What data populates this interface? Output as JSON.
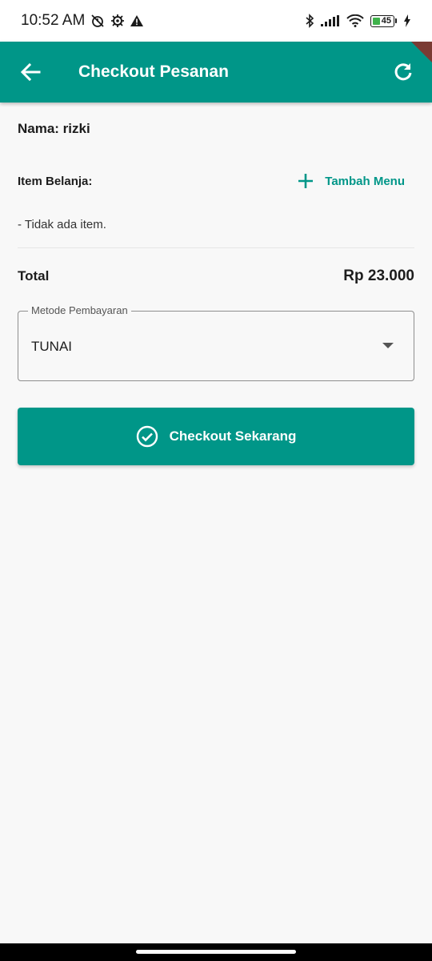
{
  "status_bar": {
    "time": "10:52 AM",
    "battery_level": "45",
    "icons": [
      "alarm-off-icon",
      "settings-gear-icon",
      "warning-icon",
      "bluetooth-icon",
      "signal-icon",
      "wifi-icon",
      "battery-icon",
      "charging-icon"
    ]
  },
  "app_bar": {
    "title": "Checkout Pesanan",
    "back_icon": "arrow-left-icon",
    "refresh_icon": "refresh-icon"
  },
  "order": {
    "name_line": "Nama: rizki",
    "items_label": "Item Belanja:",
    "add_menu_label": "Tambah Menu",
    "empty_items_text": "- Tidak ada item.",
    "total_label": "Total",
    "total_value": "Rp 23.000"
  },
  "payment": {
    "label": "Metode Pembayaran",
    "selected": "TUNAI"
  },
  "checkout_button": {
    "label": "Checkout Sekarang"
  },
  "colors": {
    "primary": "#009688",
    "background": "#f8f8f8",
    "text": "#1d1d1d"
  }
}
